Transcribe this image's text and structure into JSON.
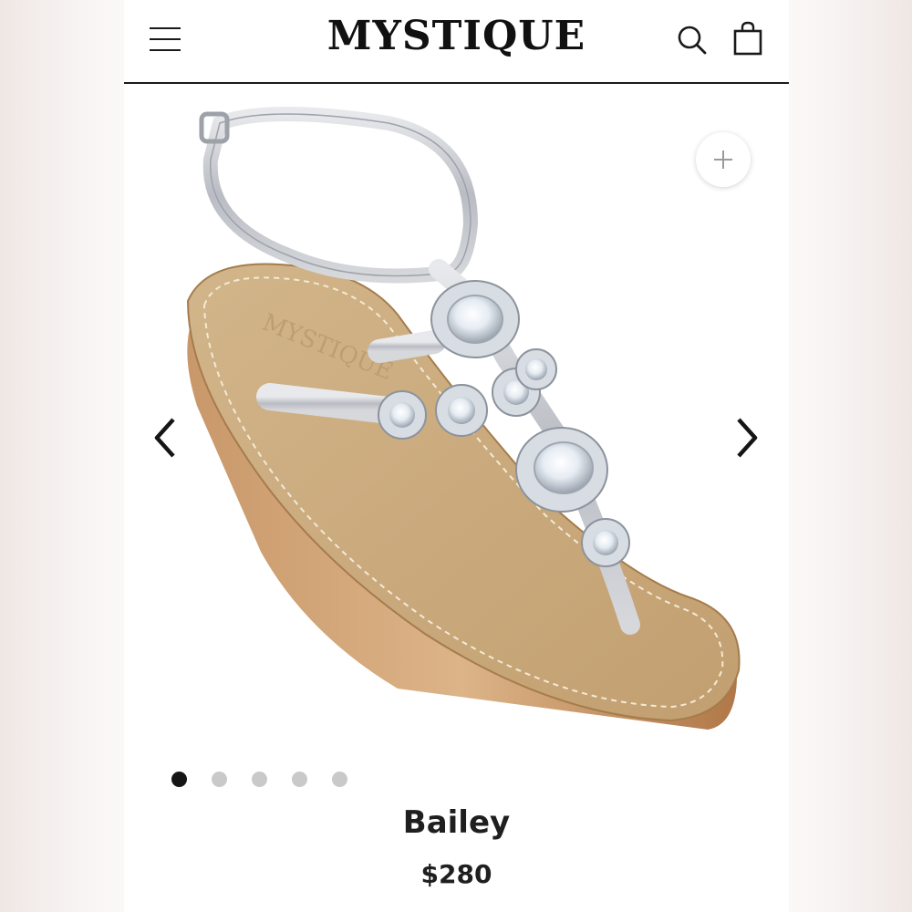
{
  "header": {
    "brand": "MYSTIQUE"
  },
  "icons": {
    "menu": "menu-icon",
    "search": "search-icon",
    "cart": "shopping-bag-icon",
    "zoom": "plus-icon",
    "prev": "chevron-left-icon",
    "next": "chevron-right-icon"
  },
  "gallery": {
    "image_count": 5,
    "active_index": 0
  },
  "product": {
    "name": "Bailey",
    "price": "$280"
  },
  "colors": {
    "accent": "#151515",
    "dot_inactive": "#c9c9c9",
    "sole": "#c8a878",
    "wedge": "#b8865a",
    "strap": "#c4c6cc"
  }
}
